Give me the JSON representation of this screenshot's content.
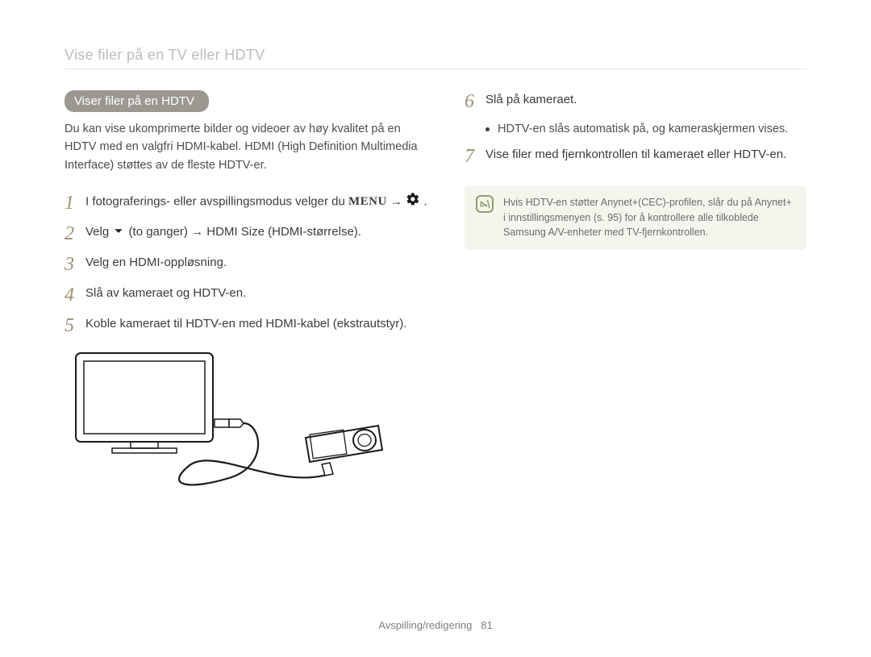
{
  "header": "Vise filer på en TV eller HDTV",
  "pill_label": "Viser ﬁler på en HDTV",
  "intro": "Du kan vise ukomprimerte bilder og videoer av høy kvalitet på en HDTV med en valgfri HDMI-kabel. HDMI (High Definition Multimedia Interface) støttes av de fleste HDTV-er.",
  "steps": {
    "s1_pre": "I fotograferings- eller avspillingsmodus velger du ",
    "s1_arrow": " → ",
    "s2_pre": "Velg ",
    "s2_mid1": " (to ganger) → ",
    "s2_bold": "HDMI Size",
    "s2_light2": " (HDMI-størrelse).",
    "s3": "Velg en HDMI-oppløsning.",
    "s4": "Slå av kameraet og HDTV-en.",
    "s5": "Koble kameraet til HDTV-en med HDMI-kabel (ekstrautstyr).",
    "s6": "Slå på kameraet.",
    "s6_bullet": "HDTV-en slås automatisk på, og kameraskjermen vises.",
    "s7": "Vise filer med fjernkontrollen til kameraet eller HDTV-en."
  },
  "note": "Hvis HDTV-en støtter Anynet+(CEC)-profilen, slår du på Anynet+ i innstillingsmenyen (s. 95) for å kontrollere alle tilkoblede Samsung A/V-enheter med TV-fjernkontrollen.",
  "footer_label": "Avspilling/redigering",
  "footer_page": "81"
}
